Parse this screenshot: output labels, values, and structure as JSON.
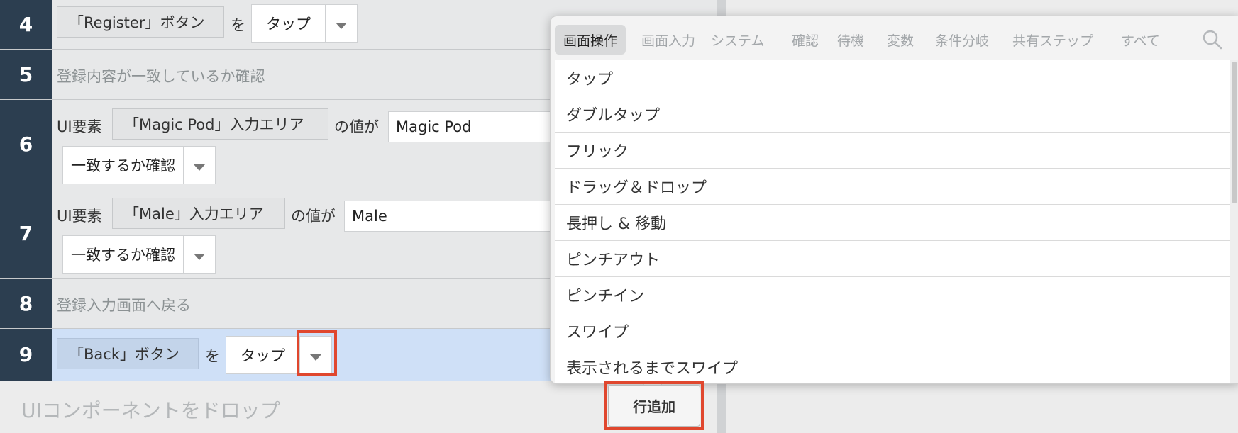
{
  "steps": [
    {
      "num": "4",
      "target": "「Register」ボタン",
      "particle": "を",
      "action": "タップ"
    },
    {
      "num": "5",
      "comment": "登録内容が一致しているか確認"
    },
    {
      "num": "6",
      "prefix": "UI要素",
      "target": "「Magic Pod」入力エリア",
      "particle": "の値が",
      "value": "Magic Pod",
      "action": "一致するか確認"
    },
    {
      "num": "7",
      "prefix": "UI要素",
      "target": "「Male」入力エリア",
      "particle": "の値が",
      "value": "Male",
      "action": "一致するか確認"
    },
    {
      "num": "8",
      "comment": "登録入力画面へ戻る"
    },
    {
      "num": "9",
      "target": "「Back」ボタン",
      "particle": "を",
      "action": "タップ"
    }
  ],
  "drop_zone": {
    "placeholder": "UIコンポーネントをドロップ"
  },
  "add_row_button": "行追加",
  "popup": {
    "tabs": [
      "画面操作",
      "画面入力",
      "システム",
      "確認",
      "待機",
      "変数",
      "条件分岐",
      "共有ステップ",
      "すべて"
    ],
    "active_tab": "画面操作",
    "items": [
      "タップ",
      "ダブルタップ",
      "フリック",
      "ドラッグ＆ドロップ",
      "長押し & 移動",
      "ピンチアウト",
      "ピンチイン",
      "スワイプ",
      "表示されるまでスワイプ"
    ]
  },
  "colors": {
    "step_number_bg": "#2c3e50",
    "selected_row_bg": "#cfe0f7",
    "highlight": "#e0472e"
  },
  "icons": {
    "search": "search-icon",
    "dropdown": "chevron-down-icon"
  }
}
